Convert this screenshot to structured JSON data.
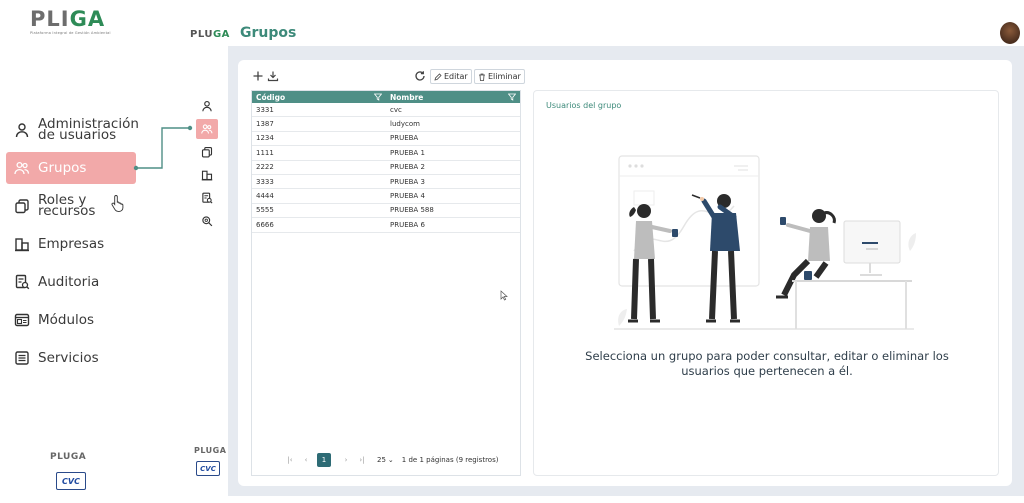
{
  "brand": {
    "logo_left": "PLI",
    "logo_right": "GA",
    "tagline": "Plataforma Integral de Gestión Ambiental"
  },
  "explainer_menu": {
    "items": [
      {
        "label": "Administración\nde usuarios",
        "icon": "user-icon"
      },
      {
        "label": "Grupos",
        "icon": "group-icon",
        "active": true
      },
      {
        "label": "Roles y\nrecursos",
        "icon": "copy-icon"
      },
      {
        "label": "Empresas",
        "icon": "building-icon"
      },
      {
        "label": "Auditoria",
        "icon": "audit-icon"
      },
      {
        "label": "Módulos",
        "icon": "module-icon"
      },
      {
        "label": "Servicios",
        "icon": "list-icon"
      }
    ]
  },
  "mini_menu": {
    "items": [
      {
        "icon": "user-icon"
      },
      {
        "icon": "group-icon",
        "active": true
      },
      {
        "icon": "copy-icon"
      },
      {
        "icon": "building-icon"
      },
      {
        "icon": "audit-icon"
      },
      {
        "icon": "gear-search-icon"
      }
    ]
  },
  "header": {
    "logo_left": "PLU",
    "logo_right": "GA",
    "title": "Grupos"
  },
  "footer": {
    "logo_text": "PLUGA",
    "cvc_text": "CVC"
  },
  "toolbar": {
    "edit_label": "Editar",
    "delete_label": "Eliminar"
  },
  "grid": {
    "columns": [
      "Código",
      "Nombre"
    ],
    "rows": [
      [
        "3331",
        "cvc"
      ],
      [
        "1387",
        "ludycom"
      ],
      [
        "1234",
        "PRUEBA"
      ],
      [
        "1111",
        "PRUEBA 1"
      ],
      [
        "2222",
        "PRUEBA 2"
      ],
      [
        "3333",
        "PRUEBA 3"
      ],
      [
        "4444",
        "PRUEBA 4"
      ],
      [
        "5555",
        "PRUEBA 588"
      ],
      [
        "6666",
        "PRUEBA 6"
      ]
    ]
  },
  "pager": {
    "current_page": "1",
    "page_size": "25",
    "info": "1 de 1 páginas (9 registros)"
  },
  "panel": {
    "title": "Usuarios del grupo",
    "message": "Selecciona un grupo para poder consultar, editar o eliminar los usuarios que pertenecen a él."
  }
}
